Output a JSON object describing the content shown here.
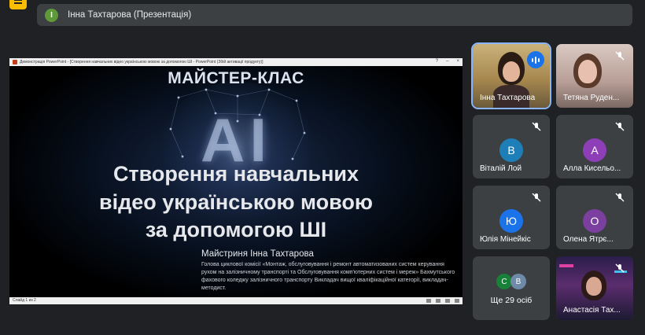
{
  "presenter_bar": {
    "initial": "І",
    "label": "Інна Тахтарова (Презентація)"
  },
  "window": {
    "title": "Демонстрація PowerPoint - [Створення навчальних відео українською мовою за допомогою ШІ - PowerPoint (Збій активації продукту)]",
    "controls": [
      "?",
      "–",
      "×"
    ]
  },
  "slide": {
    "title": "МАЙСТЕР-КЛАС",
    "ai_mark": "AI",
    "headline": [
      "Створення навчальних",
      "відео українською мовою",
      "за допомогою ШІ"
    ],
    "author": "Майстриня Інна Тахтарова",
    "description": "Голова циклової комісії «Монтаж, обслуговування і ремонт автоматизованих систем керування рухом на залізничному транспорті та Обслуговування комп'ютерних систем і мереж» Бахмутського фахового коледжу залізничного транспорту Викладач вищої кваліфікаційної категорії, викладач-методист."
  },
  "statusbar": {
    "text": "Слайд 1 из 2"
  },
  "participants": [
    {
      "name": "Інна Тахтарова",
      "speaking": true
    },
    {
      "name": "Тетяна Руден..."
    },
    {
      "name": "Віталій Лой",
      "initial": "В",
      "color": "#1e7fb8"
    },
    {
      "name": "Алла Кисельо...",
      "initial": "А",
      "color": "#8e3fb8"
    },
    {
      "name": "Юлія Мінейкіс",
      "initial": "Ю",
      "color": "#1a73e8"
    },
    {
      "name": "Олена Ятрє...",
      "initial": "О",
      "color": "#7b3fa0"
    },
    {
      "name": "Анастасія Тах..."
    }
  ],
  "more": {
    "label": "Ще 29 осіб",
    "avatars": [
      {
        "initial": "С",
        "color": "#188038"
      },
      {
        "initial": "В",
        "color": "#6f8aa8"
      }
    ]
  },
  "colors": {
    "accent": "#8ab4f8",
    "tile_bg": "#3c4043",
    "page_bg": "#202124"
  },
  "icons": {
    "muted": "mic-off-icon",
    "speaking": "audio-level-icon"
  }
}
